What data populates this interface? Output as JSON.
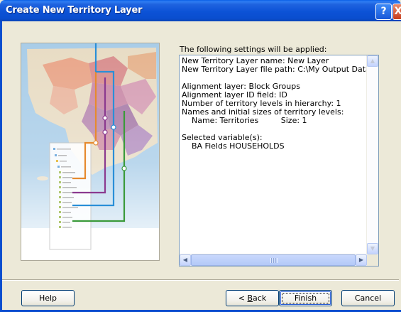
{
  "window": {
    "title": "Create New Territory Layer",
    "help_glyph": "?",
    "close_glyph": "X"
  },
  "summary": {
    "heading": "The following settings will be applied:",
    "lines": [
      "New Territory Layer name: New Layer",
      "New Territory Layer file path: C:\\My Output Data\\tdlaye",
      "",
      "Alignment layer: Block Groups",
      "Alignment layer ID field: ID",
      "Number of territory levels in hierarchy: 1",
      "Names and initial sizes of territory levels:",
      "    Name: Territories         Size: 1",
      "",
      "Selected variable(s):",
      "    BA Fields HOUSEHOLDS"
    ]
  },
  "scrollbars": {
    "up_arrow": "▲",
    "down_arrow": "▼",
    "left_arrow": "◀",
    "right_arrow": "▶"
  },
  "buttons": {
    "help": "Help",
    "back_mnemonic": "B",
    "back_rest": "ack",
    "back_prefix": "< ",
    "finish": "Finish",
    "cancel": "Cancel"
  },
  "colors": {
    "title_bar": "#0a4ecf",
    "dialog_bg": "#ece9d8",
    "line_orange": "#e68a2e",
    "line_purple": "#8b3a8f",
    "line_blue": "#2a8fd8",
    "line_green": "#3a9a3a"
  }
}
